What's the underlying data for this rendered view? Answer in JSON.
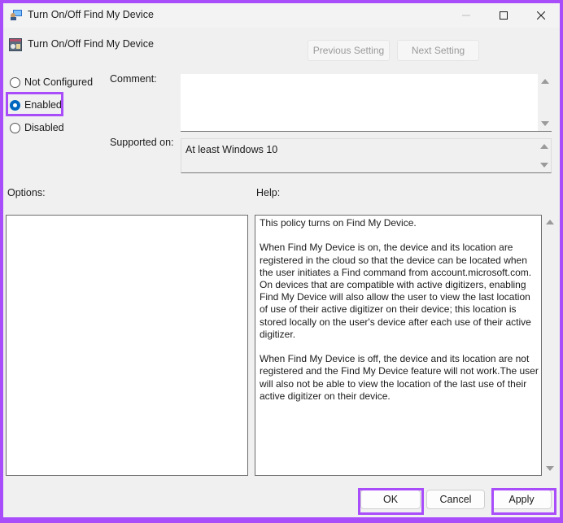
{
  "window": {
    "title": "Turn On/Off Find My Device",
    "controls": {
      "minimize": "minimize",
      "maximize": "maximize",
      "close": "close"
    }
  },
  "header": {
    "policy_title": "Turn On/Off Find My Device",
    "previous_setting": "Previous Setting",
    "next_setting": "Next Setting"
  },
  "state": {
    "options": [
      {
        "label": "Not Configured",
        "checked": false
      },
      {
        "label": "Enabled",
        "checked": true
      },
      {
        "label": "Disabled",
        "checked": false
      }
    ]
  },
  "comment": {
    "label": "Comment:",
    "value": ""
  },
  "supported": {
    "label": "Supported on:",
    "value": "At least Windows 10"
  },
  "options_section": {
    "label": "Options:"
  },
  "help": {
    "label": "Help:",
    "text": "This policy turns on Find My Device.\n\nWhen Find My Device is on, the device and its location are registered in the cloud so that the device can be located when the user initiates a Find command from account.microsoft.com. On devices that are compatible with active digitizers, enabling Find My Device will also allow the user to view the last location of use of their active digitizer on their device; this location is stored locally on the user's device after each use of their active digitizer.\n\nWhen Find My Device is off, the device and its location are not registered and the Find My Device feature will not work.The user will also not be able to view the location of the last use of their active digitizer on their device."
  },
  "footer": {
    "ok": "OK",
    "cancel": "Cancel",
    "apply": "Apply"
  },
  "colors": {
    "highlight": "#a94dfb",
    "radio_accent": "#0067c0"
  }
}
